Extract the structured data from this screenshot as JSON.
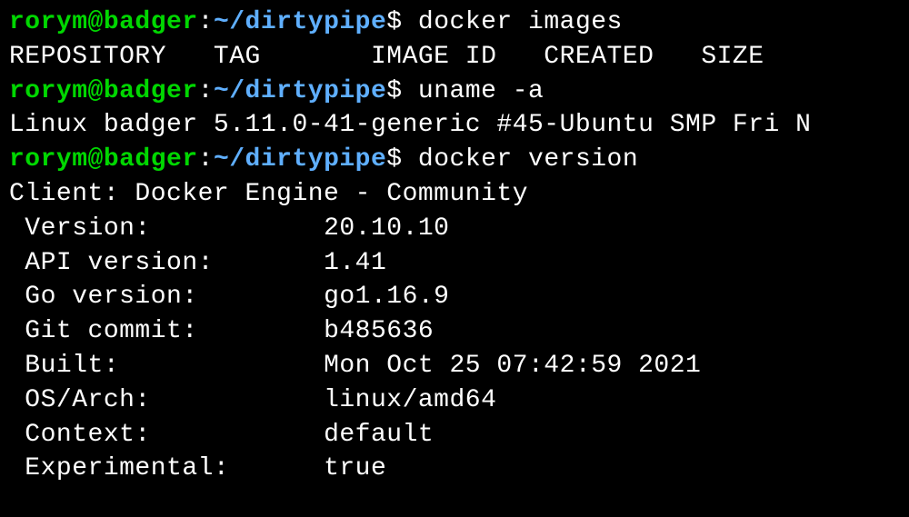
{
  "prompt": {
    "user_host": "rorym@badger",
    "colon": ":",
    "path": "~/dirtypipe",
    "dollar": "$"
  },
  "commands": {
    "cmd1": "docker images",
    "cmd2": "uname -a",
    "cmd3": "docker version"
  },
  "output": {
    "docker_images_header": "REPOSITORY   TAG       IMAGE ID   CREATED   SIZE",
    "uname": "Linux badger 5.11.0-41-generic #45-Ubuntu SMP Fri N",
    "docker_version_header": "Client: Docker Engine - Community",
    "client": {
      "version_label": " Version:           ",
      "version_value": "20.10.10",
      "api_label": " API version:       ",
      "api_value": "1.41",
      "go_label": " Go version:        ",
      "go_value": "go1.16.9",
      "git_label": " Git commit:        ",
      "git_value": "b485636",
      "built_label": " Built:             ",
      "built_value": "Mon Oct 25 07:42:59 2021",
      "osarch_label": " OS/Arch:           ",
      "osarch_value": "linux/amd64",
      "context_label": " Context:           ",
      "context_value": "default",
      "experimental_label": " Experimental:      ",
      "experimental_value": "true"
    }
  }
}
